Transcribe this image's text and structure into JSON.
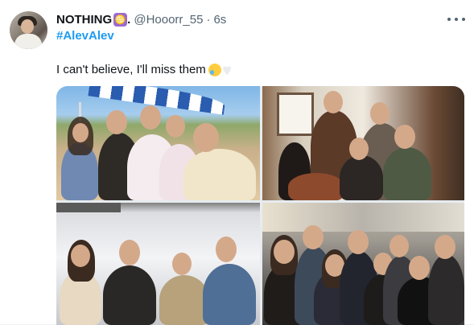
{
  "tweet": {
    "display_name": "NOTHING",
    "badge_emoji": "♋",
    "name_suffix": ".",
    "handle": "@Hooorr_55",
    "separator": "·",
    "time": "6s",
    "hashtag": "#AlevAlev",
    "text": "I can't believe, I'll miss them",
    "emojis": [
      "face-holding-back-tears",
      "white-heart"
    ]
  },
  "icons": {
    "more": "more-dots-icon"
  },
  "media": {
    "photo_count": 4
  },
  "colors": {
    "link_blue": "#1d9bf0",
    "secondary_text": "#536471",
    "badge_purple": "#9b6bcc"
  }
}
